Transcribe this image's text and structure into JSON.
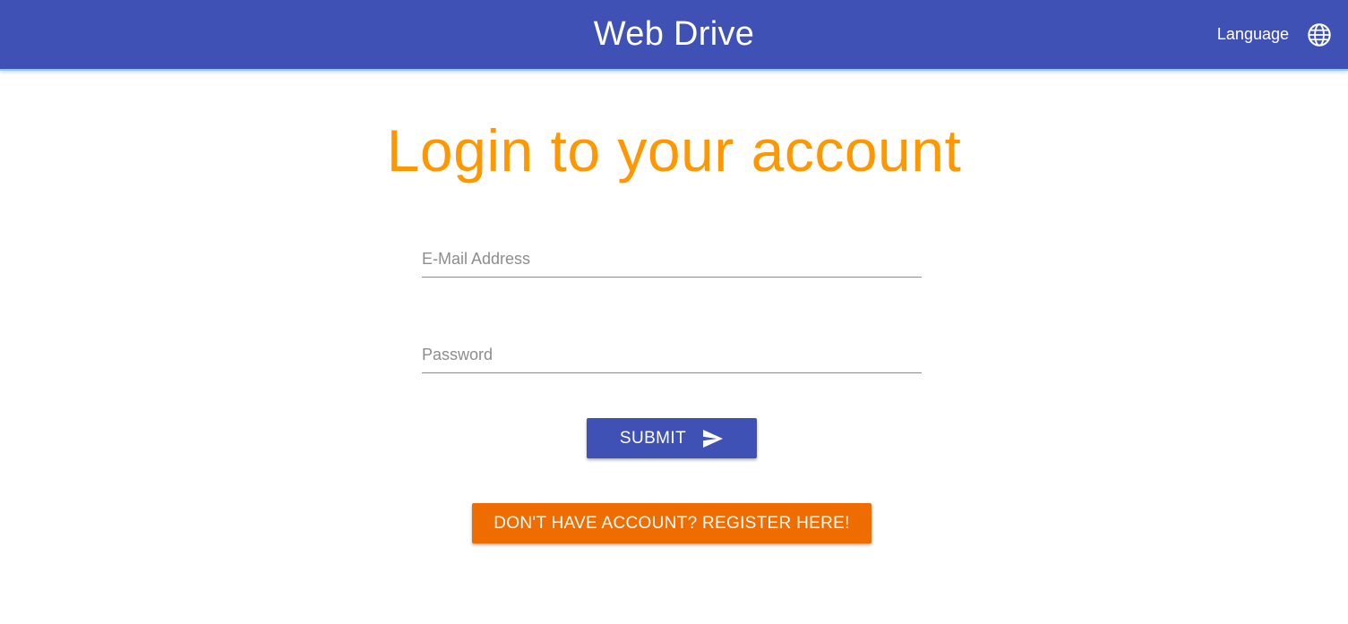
{
  "header": {
    "title": "Web Drive",
    "language_label": "Language",
    "language_icon": "globe-icon",
    "background_color": "#3f51b5"
  },
  "main": {
    "heading": "Login to your account",
    "heading_color": "#ff9800",
    "email": {
      "placeholder": "E-Mail Address",
      "value": ""
    },
    "password": {
      "placeholder": "Password",
      "value": ""
    },
    "submit": {
      "label": "SUBMIT",
      "icon": "send-icon",
      "color": "#3f51b5"
    },
    "register": {
      "label": "DON'T HAVE ACCOUNT? REGISTER HERE!",
      "color": "#ef6c00"
    }
  }
}
